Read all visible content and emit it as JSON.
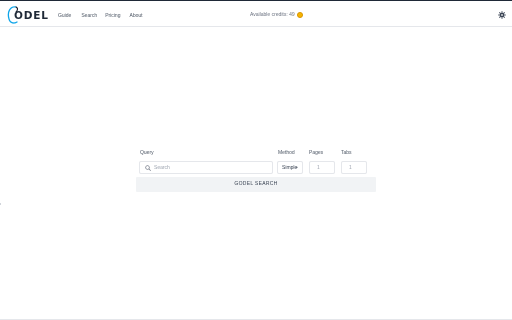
{
  "brand": {
    "logo_text": "ODEL"
  },
  "nav": {
    "items": [
      "Guide",
      "Search",
      "Pricing",
      "About"
    ]
  },
  "header": {
    "credits_text": "Available credits: 49",
    "credit_icon": "coin-icon",
    "settings_icon": "gear-icon"
  },
  "form": {
    "query_label": "Query",
    "query_placeholder": "Search",
    "method_label": "Method",
    "method_value": "Simple",
    "pages_label": "Pages",
    "pages_value": "1",
    "tabs_label": "Tabs",
    "tabs_value": "1",
    "submit_label": "GODEL SEARCH"
  },
  "colors": {
    "accent": "#0ea5e9",
    "button_bg": "#f1f3f5",
    "coin": "#f5b301"
  }
}
